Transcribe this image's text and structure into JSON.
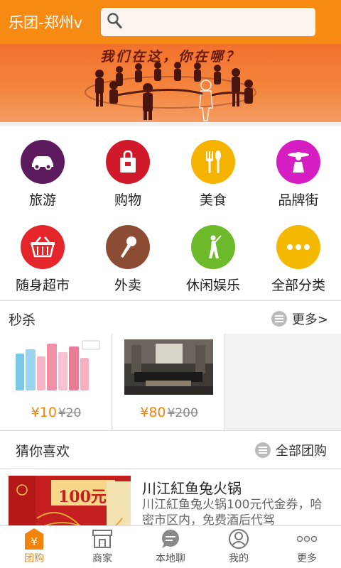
{
  "header": {
    "city": "乐团-郑州v",
    "search_placeholder": ""
  },
  "banner": {
    "slogan": "我们在这，你在哪？"
  },
  "categories": [
    {
      "label": "旅游",
      "icon": "car-icon",
      "color": "#5d1b5e"
    },
    {
      "label": "购物",
      "icon": "shopping-bag-icon",
      "color": "#d0192a"
    },
    {
      "label": "美食",
      "icon": "fork-spoon-icon",
      "color": "#f5b300"
    },
    {
      "label": "品牌街",
      "icon": "fashion-figure-icon",
      "color": "#d61dc2"
    },
    {
      "label": "随身超市",
      "icon": "basket-icon",
      "color": "#e4252a"
    },
    {
      "label": "外卖",
      "icon": "microphone-icon",
      "color": "#8c4c33"
    },
    {
      "label": "休闲娱乐",
      "icon": "golfer-icon",
      "color": "#6dbb2a"
    },
    {
      "label": "全部分类",
      "icon": "more-dots-icon",
      "color": "#f5b800"
    }
  ],
  "flash_sale": {
    "title": "秒杀",
    "more": "更多>",
    "items": [
      {
        "price": "¥10",
        "original": "¥20"
      },
      {
        "price": "¥80",
        "original": "¥200"
      }
    ]
  },
  "recommend": {
    "title": "猜你喜欢",
    "more": "全部团购",
    "items": [
      {
        "title": "川江紅鱼兔火锅",
        "desc": "川江紅鱼兔火锅100元代金券，哈密市区内，免费酒后代驾",
        "thumb_text": "100元"
      }
    ]
  },
  "bottom_nav": [
    {
      "label": "团购",
      "icon": "yen-tag-icon",
      "active": true
    },
    {
      "label": "商家",
      "icon": "store-icon",
      "active": false
    },
    {
      "label": "本地聊",
      "icon": "chat-bubble-icon",
      "active": false
    },
    {
      "label": "我的",
      "icon": "user-icon",
      "active": false
    },
    {
      "label": "更多",
      "icon": "more-icon",
      "active": false
    }
  ]
}
